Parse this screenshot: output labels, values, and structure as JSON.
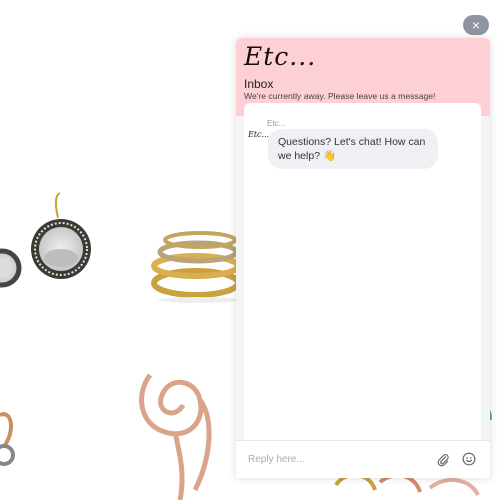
{
  "widget": {
    "logo": "Etc...",
    "inbox_title": "Inbox",
    "away_message": "We're currently away. Please leave us a message!",
    "sender_name": "Etc...",
    "avatar_text": "Etc...",
    "message": "Questions? Let's chat! How can we help? 👋",
    "reply_placeholder": "Reply here..."
  },
  "close_label": "×",
  "icons": [
    "close-icon",
    "paperclip-icon",
    "emoji-icon"
  ],
  "colors": {
    "header_bg": "#ffcfd6",
    "bubble_bg": "#eef0f3",
    "close_bg": "#8e95a1"
  }
}
